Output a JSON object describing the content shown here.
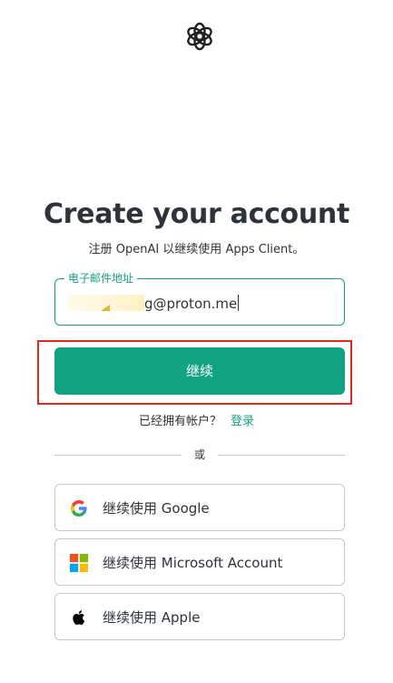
{
  "logo": {
    "icon": "openai-logo-icon"
  },
  "heading": {
    "title": "Create your account",
    "subtitle": "注册 OpenAI 以继续使用 Apps Client。"
  },
  "email_field": {
    "label": "电子邮件地址",
    "value_visible_suffix": "g@proton.me"
  },
  "continue_button": {
    "label": "继续",
    "color": "#10a37f"
  },
  "login_prompt": {
    "text": "已经拥有帐户？",
    "link": "登录"
  },
  "divider": {
    "text": "或"
  },
  "social_buttons": [
    {
      "label": "继续使用 Google",
      "icon": "google-icon"
    },
    {
      "label": "继续使用 Microsoft Account",
      "icon": "microsoft-icon"
    },
    {
      "label": "继续使用 Apple",
      "icon": "apple-icon"
    }
  ],
  "highlight_color": "#e0281b"
}
